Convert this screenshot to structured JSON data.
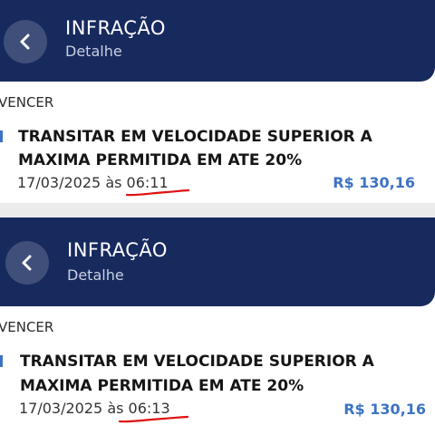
{
  "screens": [
    {
      "header": {
        "back_icon": "chevron-left-icon",
        "title": "INFRAÇÃO",
        "subtitle": "Detalhe"
      },
      "section_label": "VENCER",
      "infraction": {
        "description_line1": "TRANSITAR EM VELOCIDADE SUPERIOR A",
        "description_line2": "MAXIMA PERMITIDA EM ATE 20%",
        "date": "17/03/2025",
        "at": "às",
        "time": "06:11",
        "amount": "R$ 130,16"
      }
    },
    {
      "header": {
        "back_icon": "chevron-left-icon",
        "title": "INFRAÇÃO",
        "subtitle": "Detalhe"
      },
      "section_label": "VENCER",
      "infraction": {
        "description_line1": "TRANSITAR EM VELOCIDADE SUPERIOR A",
        "description_line2": "MAXIMA PERMITIDA EM ATE 20%",
        "date": "17/03/2025",
        "at": "às",
        "time": "06:13",
        "amount": "R$ 130,16"
      }
    }
  ],
  "colors": {
    "header_bg": "#172a5e",
    "back_button_bg": "#3f4f79",
    "accent": "#3d73c4",
    "annotation_underline": "#e01010"
  }
}
